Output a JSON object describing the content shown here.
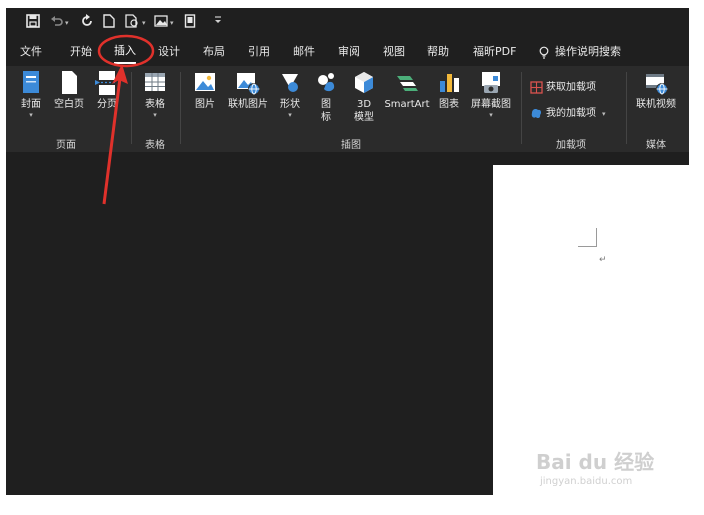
{
  "window": {
    "background": "#1f1f1f",
    "ribbon_background": "#2b2b2b",
    "page_color": "#ffffff"
  },
  "qat": {
    "items": [
      "save-icon",
      "undo-icon",
      "redo-icon",
      "new-doc-icon",
      "format-painter-icon",
      "picture-icon",
      "page-icon",
      "customize-icon"
    ]
  },
  "tabs": [
    {
      "label": "文件"
    },
    {
      "label": "开始"
    },
    {
      "label": "插入",
      "active": true
    },
    {
      "label": "设计"
    },
    {
      "label": "布局"
    },
    {
      "label": "引用"
    },
    {
      "label": "邮件"
    },
    {
      "label": "审阅"
    },
    {
      "label": "视图"
    },
    {
      "label": "帮助"
    },
    {
      "label": "福昕PDF"
    }
  ],
  "search": {
    "label": "操作说明搜索",
    "icon": "lightbulb-icon"
  },
  "ribbon": {
    "pages": {
      "label": "页面",
      "buttons": [
        {
          "label": "封面",
          "icon": "cover-page-icon",
          "dropdown": true
        },
        {
          "label": "空白页",
          "icon": "blank-page-icon"
        },
        {
          "label": "分页",
          "icon": "page-break-icon"
        }
      ]
    },
    "tables": {
      "label": "表格",
      "buttons": [
        {
          "label": "表格",
          "icon": "table-icon",
          "dropdown": true
        }
      ]
    },
    "illustrations": {
      "label": "插图",
      "buttons": [
        {
          "label": "图片",
          "icon": "picture-icon"
        },
        {
          "label": "联机图片",
          "icon": "online-picture-icon"
        },
        {
          "label": "形状",
          "icon": "shapes-icon",
          "dropdown": true
        },
        {
          "label": "图标",
          "line1": "图",
          "line2": "标",
          "icon": "icons-icon"
        },
        {
          "label": "3D模型",
          "line1": "3D",
          "line2": "模型",
          "icon": "3d-model-icon"
        },
        {
          "label": "SmartArt",
          "icon": "smartart-icon"
        },
        {
          "label": "图表",
          "icon": "chart-icon"
        },
        {
          "label": "屏幕截图",
          "icon": "screenshot-icon",
          "dropdown": true
        }
      ]
    },
    "addins": {
      "label": "加载项",
      "buttons": [
        {
          "label": "获取加载项",
          "icon": "store-icon"
        },
        {
          "label": "我的加载项",
          "icon": "my-addins-icon",
          "dropdown": true
        }
      ]
    },
    "media": {
      "label": "媒体",
      "buttons": [
        {
          "label": "联机视频",
          "icon": "online-video-icon"
        }
      ]
    }
  },
  "document": {
    "paragraph_mark": "↵"
  },
  "annotation": {
    "highlight_color": "#e0312b",
    "target": "插入"
  },
  "watermark": {
    "logo_text": "Bai du 经验",
    "url_text": "jingyan.baidu.com"
  }
}
